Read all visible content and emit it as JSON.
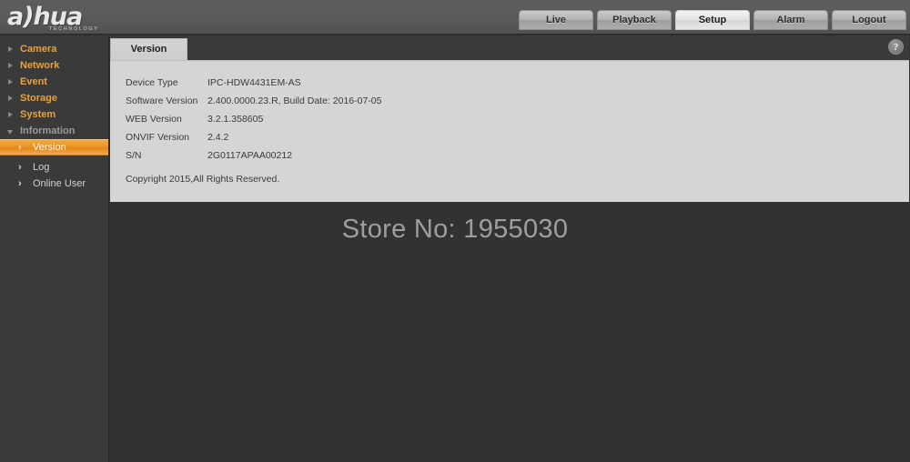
{
  "brand": {
    "logo_text": "a)hua",
    "logo_sub": "TECHNOLOGY"
  },
  "topnav": {
    "tabs": [
      {
        "label": "Live",
        "active": false
      },
      {
        "label": "Playback",
        "active": false
      },
      {
        "label": "Setup",
        "active": true
      },
      {
        "label": "Alarm",
        "active": false
      },
      {
        "label": "Logout",
        "active": false
      }
    ]
  },
  "sidebar": {
    "items": [
      {
        "label": "Camera",
        "expanded": false
      },
      {
        "label": "Network",
        "expanded": false
      },
      {
        "label": "Event",
        "expanded": false
      },
      {
        "label": "Storage",
        "expanded": false
      },
      {
        "label": "System",
        "expanded": false
      },
      {
        "label": "Information",
        "expanded": true
      }
    ],
    "sub_items": [
      {
        "label": "Version",
        "chevron": "›",
        "selected": true
      },
      {
        "label": "Log",
        "chevron": "›",
        "selected": false
      },
      {
        "label": "Online User",
        "chevron": "›",
        "selected": false
      }
    ]
  },
  "panel": {
    "tab_label": "Version",
    "help_glyph": "?",
    "rows": [
      {
        "label": "Device Type",
        "value": "IPC-HDW4431EM-AS"
      },
      {
        "label": "Software Version",
        "value": "2.400.0000.23.R, Build Date: 2016-07-05"
      },
      {
        "label": "WEB Version",
        "value": "3.2.1.358605"
      },
      {
        "label": "ONVIF Version",
        "value": "2.4.2"
      },
      {
        "label": "S/N",
        "value": "2G0117APAA00212"
      }
    ],
    "copyright": "Copyright 2015,All Rights Reserved."
  },
  "watermark": {
    "text": "Store No: 1955030"
  },
  "colors": {
    "accent_orange": "#ec9426",
    "sidebar_bg": "#3a3a3a",
    "page_bg": "#323232",
    "panel_bg": "#d5d5d5",
    "header_bg": "#5a5a5a"
  }
}
